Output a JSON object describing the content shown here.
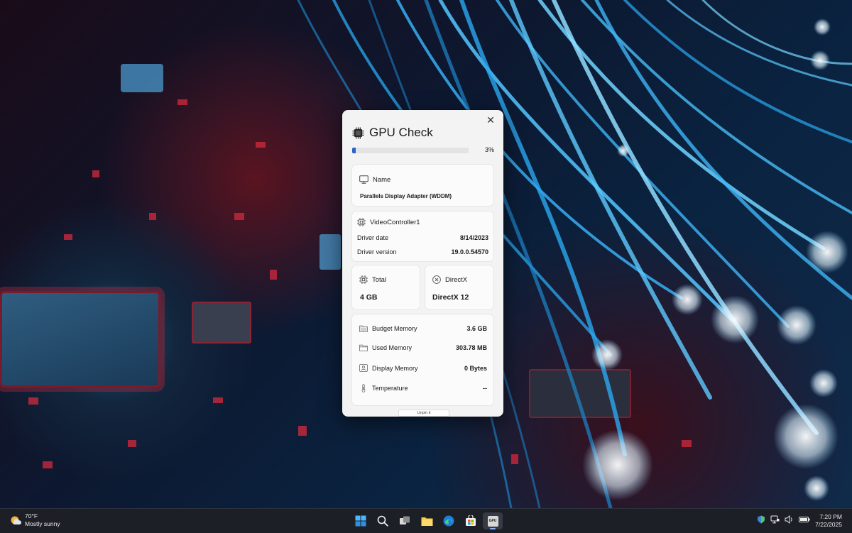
{
  "window": {
    "title": "GPU Check",
    "close_glyph": "✕",
    "progress": {
      "percent_value": 3,
      "label": "3%"
    },
    "name_card": {
      "heading": "Name",
      "value": "Parallels Display Adapter (WDDM)"
    },
    "controller_card": {
      "heading": "VideoController1",
      "rows": [
        {
          "label": "Driver date",
          "value": "8/14/2023"
        },
        {
          "label": "Driver version",
          "value": "19.0.0.54570"
        }
      ]
    },
    "total_card": {
      "heading": "Total",
      "value": "4 GB"
    },
    "directx_card": {
      "heading": "DirectX",
      "value": "DirectX 12"
    },
    "memory_card": {
      "rows": [
        {
          "label": "Budget Memory",
          "value": "3.6 GB",
          "icon": "folder-icon"
        },
        {
          "label": "Used Memory",
          "value": "303.78 MB",
          "icon": "folder-outline-icon"
        },
        {
          "label": "Display Memory",
          "value": "0 Bytes",
          "icon": "display-memory-icon"
        },
        {
          "label": "Temperature",
          "value": "--",
          "icon": "thermometer-icon"
        }
      ]
    },
    "unpin_label": "Unpin it"
  },
  "taskbar": {
    "weather": {
      "temp": "70°F",
      "condition": "Mostly sunny"
    },
    "apps": [
      "start-icon",
      "search-icon",
      "task-view-icon",
      "file-explorer-icon",
      "edge-icon",
      "store-icon",
      "gpu-check-app-icon"
    ],
    "gpu_app_label": "GPU",
    "clock": {
      "time": "7:20 PM",
      "date": "7/22/2025"
    }
  },
  "colors": {
    "accent": "#2b63c7",
    "window_bg": "#f3f3f3",
    "card_bg": "#fbfbfb",
    "taskbar_bg": "#1c1f26"
  }
}
